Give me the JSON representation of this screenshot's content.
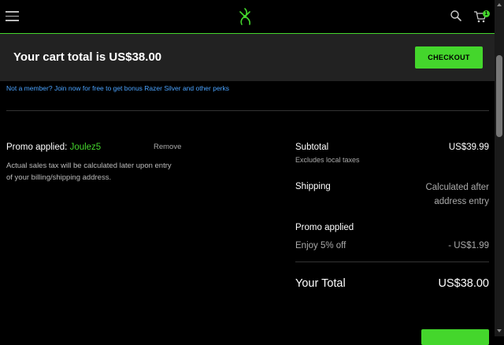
{
  "header": {
    "menu_icon": "hamburger-icon",
    "logo_icon": "razer-logo-icon",
    "search_icon": "search-icon",
    "cart_icon": "cart-icon",
    "cart_count": "1"
  },
  "summary_bar": {
    "cart_total_text": "Your cart total is US$38.00",
    "checkout_label": "CHECKOUT"
  },
  "member_promo": {
    "link_text": "Not a member? Join now for free to get bonus Razer Silver and other perks"
  },
  "promo": {
    "label": "Promo applied:",
    "code": "Joulez5",
    "remove_label": "Remove",
    "tax_note": "Actual sales tax will be calculated later upon entry of your billing/shipping address."
  },
  "order_summary": {
    "subtotal_label": "Subtotal",
    "subtotal_value": "US$39.99",
    "subtotal_note": "Excludes local taxes",
    "shipping_label": "Shipping",
    "shipping_value": "Calculated after address entry",
    "promo_label": "Promo applied",
    "promo_desc": "Enjoy 5% off",
    "promo_value": "- US$1.99",
    "total_label": "Your Total",
    "total_value": "US$38.00"
  },
  "colors": {
    "accent": "#44d62c",
    "link": "#4aa3ff",
    "background": "#000000",
    "summary_bar": "#222222"
  }
}
